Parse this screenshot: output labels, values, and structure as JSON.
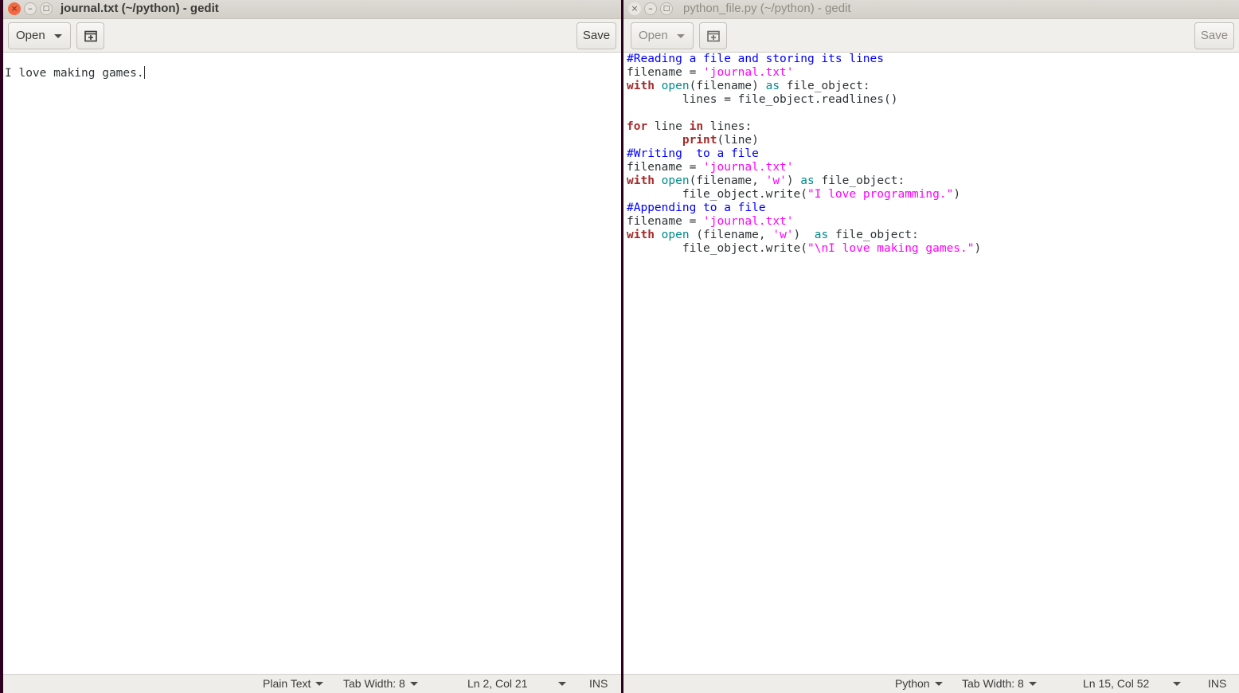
{
  "left_window": {
    "title": "journal.txt (~/python) - gedit",
    "open_label": "Open",
    "save_label": "Save",
    "content": "I love making games.",
    "status": {
      "language": "Plain Text",
      "tab_width": "Tab Width: 8",
      "position": "Ln 2, Col 21",
      "mode": "INS"
    }
  },
  "right_window": {
    "title": "python_file.py (~/python) - gedit",
    "open_label": "Open",
    "save_label": "Save",
    "code_lines": [
      [
        {
          "t": "#Reading a file and storing its lines",
          "c": "cm"
        }
      ],
      [
        {
          "t": "filename = ",
          "c": "nm"
        },
        {
          "t": "'journal.txt'",
          "c": "st"
        }
      ],
      [
        {
          "t": "with",
          "c": "kw"
        },
        {
          "t": " ",
          "c": "nm"
        },
        {
          "t": "open",
          "c": "bi"
        },
        {
          "t": "(filename) ",
          "c": "nm"
        },
        {
          "t": "as",
          "c": "bi"
        },
        {
          "t": " file_object:",
          "c": "nm"
        }
      ],
      [
        {
          "t": "        lines = file_object.readlines()",
          "c": "nm"
        }
      ],
      [
        {
          "t": "",
          "c": "nm"
        }
      ],
      [
        {
          "t": "for",
          "c": "kw"
        },
        {
          "t": " line ",
          "c": "nm"
        },
        {
          "t": "in",
          "c": "kw"
        },
        {
          "t": " lines:",
          "c": "nm"
        }
      ],
      [
        {
          "t": "        ",
          "c": "nm"
        },
        {
          "t": "print",
          "c": "kw"
        },
        {
          "t": "(line)",
          "c": "nm"
        }
      ],
      [
        {
          "t": "#Writing  to a file",
          "c": "cm"
        }
      ],
      [
        {
          "t": "filename = ",
          "c": "nm"
        },
        {
          "t": "'journal.txt'",
          "c": "st"
        }
      ],
      [
        {
          "t": "with",
          "c": "kw"
        },
        {
          "t": " ",
          "c": "nm"
        },
        {
          "t": "open",
          "c": "bi"
        },
        {
          "t": "(filename, ",
          "c": "nm"
        },
        {
          "t": "'w'",
          "c": "st"
        },
        {
          "t": ") ",
          "c": "nm"
        },
        {
          "t": "as",
          "c": "bi"
        },
        {
          "t": " file_object:",
          "c": "nm"
        }
      ],
      [
        {
          "t": "        file_object.write(",
          "c": "nm"
        },
        {
          "t": "\"I love programming.\"",
          "c": "st"
        },
        {
          "t": ")",
          "c": "nm"
        }
      ],
      [
        {
          "t": "#Appending to a file",
          "c": "cm"
        }
      ],
      [
        {
          "t": "filename = ",
          "c": "nm"
        },
        {
          "t": "'journal.txt'",
          "c": "st"
        }
      ],
      [
        {
          "t": "with",
          "c": "kw"
        },
        {
          "t": " ",
          "c": "nm"
        },
        {
          "t": "open",
          "c": "bi"
        },
        {
          "t": " (filename, ",
          "c": "nm"
        },
        {
          "t": "'w'",
          "c": "st"
        },
        {
          "t": ")  ",
          "c": "nm"
        },
        {
          "t": "as",
          "c": "bi"
        },
        {
          "t": " file_object:",
          "c": "nm"
        }
      ],
      [
        {
          "t": "        file_object.write(",
          "c": "nm"
        },
        {
          "t": "\"\\nI love making games.\"",
          "c": "st"
        },
        {
          "t": ")",
          "c": "nm"
        }
      ]
    ],
    "status": {
      "language": "Python",
      "tab_width": "Tab Width: 8",
      "position": "Ln 15, Col 52",
      "mode": "INS"
    }
  }
}
